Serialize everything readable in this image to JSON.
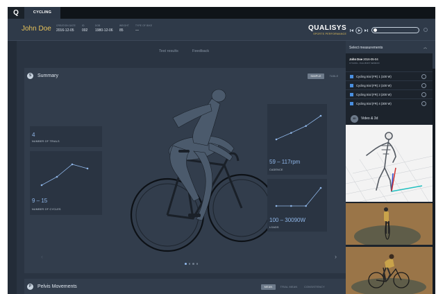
{
  "topbar": {
    "logo": "Q",
    "app_tab": "CYCLING"
  },
  "header": {
    "athlete_name": "John Doe",
    "fields": [
      {
        "label": "CREATION DATE",
        "value": "2016-12-05"
      },
      {
        "label": "ID",
        "value": "002"
      },
      {
        "label": "DOB",
        "value": "1980-12-06"
      },
      {
        "label": "WEIGHT",
        "value": "85"
      },
      {
        "label": "TYPE OF BIKE",
        "value": "—"
      }
    ],
    "brand_name": "QUALISYS",
    "brand_sub": "SPORTS PERFORMANCE"
  },
  "tabs": {
    "test_results": "Test results",
    "feedback": "Feedback"
  },
  "summary": {
    "icon": "S",
    "title": "Summary",
    "toggle_simple": "SIMPLE",
    "toggle_table": "TABLE",
    "cards": {
      "trials": {
        "value": "4",
        "label": "NUMBER OF TRIALS"
      },
      "cycles": {
        "value": "9 – 15",
        "label": "NUMBER OF CYCLES",
        "trend": [
          9,
          11,
          14,
          13
        ]
      },
      "cadence": {
        "value": "59 – 117rpm",
        "label": "CADENCE",
        "trend": [
          59,
          75,
          92,
          117
        ]
      },
      "loads": {
        "value": "100 – 30090W",
        "label": "LOADS",
        "trend": [
          100,
          100,
          100,
          30090
        ]
      }
    },
    "carousel": {
      "count": 4,
      "active": 0
    }
  },
  "pelvis": {
    "icon": "P",
    "title": "Pelvis Movements",
    "toggle_mean": "MEAN",
    "toggle_trial_mean": "TRIAL MEAN",
    "toggle_consistency": "CONSISTENCY"
  },
  "rightpanel": {
    "title": "Select measurements",
    "session_name": "John Doe",
    "session_date": "2016-05-04",
    "session_type": "CYCLING - FULL BODY SESSION",
    "trials": [
      "Cycling trial (FR) 1 (100 W)",
      "Cycling trial (FR) 2 (100 W)",
      "Cycling trial (FR) 3 (200 W)",
      "Cycling trial (FR) 4 (300 W)"
    ],
    "video_icon": "3D",
    "video_title": "Video & 3d"
  },
  "colors": {
    "accent_gold": "#e8c35a",
    "accent_blue": "#8fb6e8",
    "checkbox_blue": "#4a8fe0"
  }
}
